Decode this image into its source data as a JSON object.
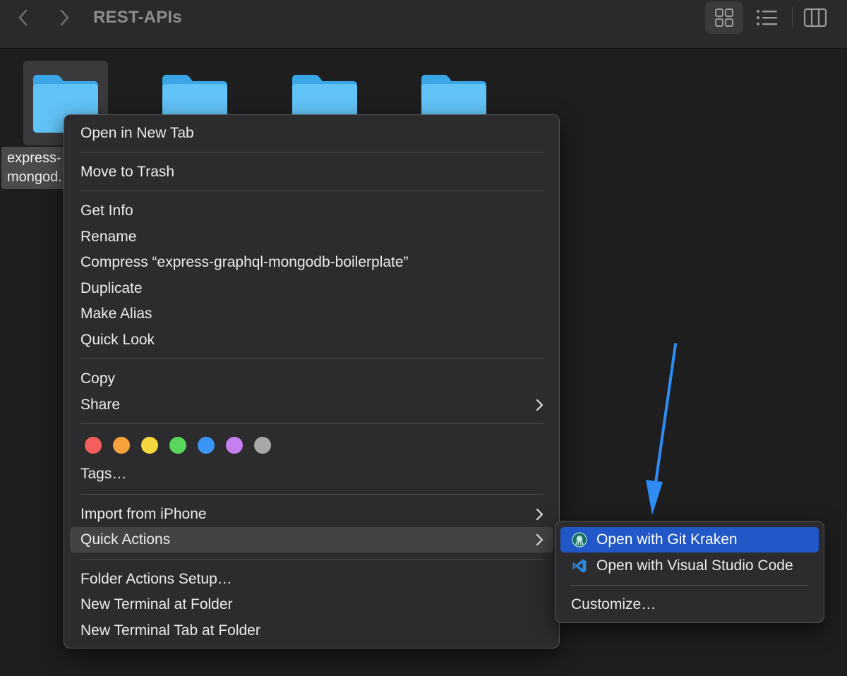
{
  "window": {
    "title": "REST-APIs"
  },
  "toolbar": {
    "back_icon": "chevron-left-icon",
    "forward_icon": "chevron-right-icon",
    "views": [
      "icon-view",
      "list-view",
      "column-view"
    ],
    "active_view": "icon-view"
  },
  "folders": [
    {
      "label": "express-graphql-mongodb-boilerplate",
      "label_visible": "express-\nmongod.",
      "selected": true
    },
    {
      "label": ""
    },
    {
      "label": ""
    },
    {
      "label": ""
    }
  ],
  "folder_color": "#62c3f7",
  "context_menu": {
    "open_in_new_tab": "Open in New Tab",
    "move_to_trash": "Move to Trash",
    "get_info": "Get Info",
    "rename": "Rename",
    "compress": "Compress “express-graphql-mongodb-boilerplate”",
    "duplicate": "Duplicate",
    "make_alias": "Make Alias",
    "quick_look": "Quick Look",
    "copy": "Copy",
    "share": "Share",
    "tag_colors": [
      "#f25f5c",
      "#f7a23a",
      "#f5d63c",
      "#5ad65c",
      "#3a95f5",
      "#c77ef2",
      "#a8a8aa"
    ],
    "tags": "Tags…",
    "import_from_iphone": "Import from iPhone",
    "quick_actions": "Quick Actions",
    "folder_actions_setup": "Folder Actions Setup…",
    "new_terminal_at_folder": "New Terminal at Folder",
    "new_terminal_tab_at_folder": "New Terminal Tab at Folder"
  },
  "quick_actions_submenu": {
    "git_kraken": "Open with Git Kraken",
    "vscode": "Open with Visual Studio Code",
    "customize": "Customize…"
  },
  "colors": {
    "highlight": "#2157c7",
    "annotation_arrow": "#2f8cf5"
  }
}
